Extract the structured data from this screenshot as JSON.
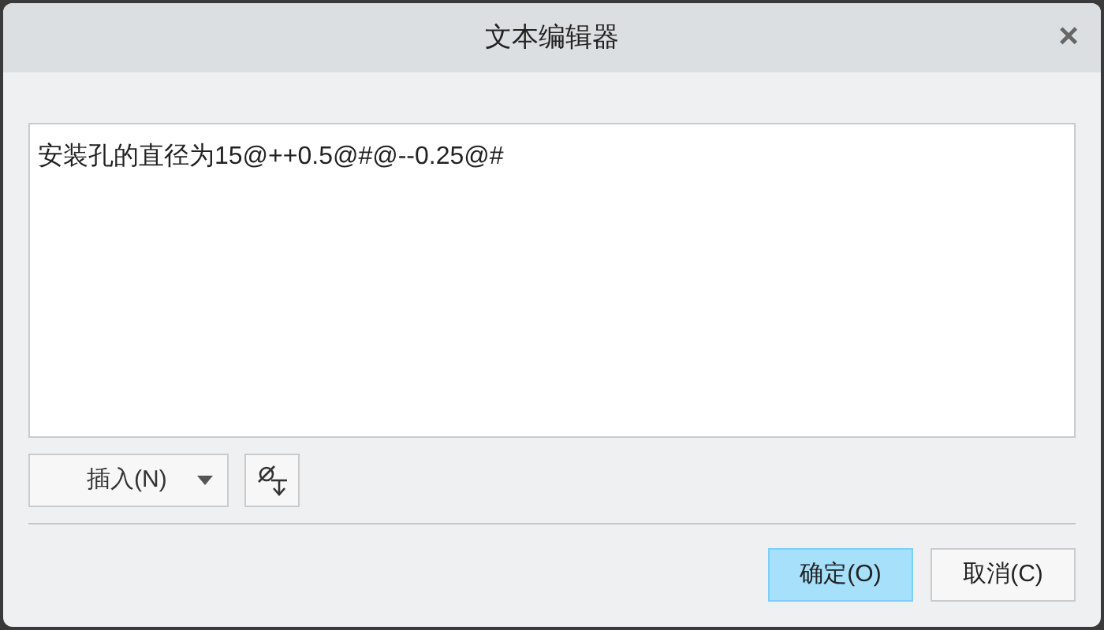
{
  "window": {
    "title": "文本编辑器",
    "close": "×"
  },
  "editor": {
    "value": "安装孔的直径为15@++0.5@#@--0.25@#"
  },
  "insert_menu": {
    "label": "插入(N)"
  },
  "buttons": [
    {
      "label": "确定(O)",
      "default": true
    },
    {
      "label": "取消(C)",
      "default": false
    }
  ]
}
